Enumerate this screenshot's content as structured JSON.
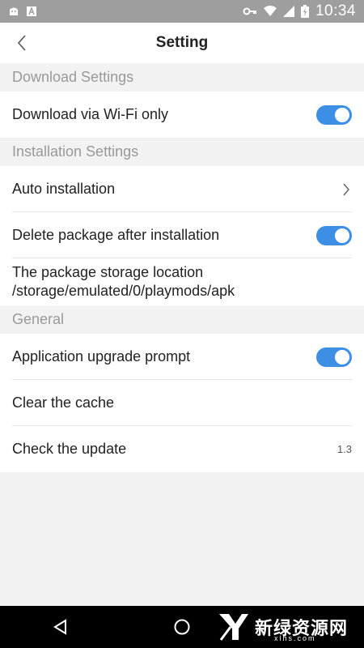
{
  "status_bar": {
    "time": "10:34"
  },
  "header": {
    "title": "Setting"
  },
  "sections": {
    "download": {
      "title": "Download Settings",
      "wifi_only": {
        "label": "Download via Wi-Fi only",
        "enabled": true
      }
    },
    "installation": {
      "title": "Installation Settings",
      "auto_install": {
        "label": "Auto installation"
      },
      "delete_package": {
        "label": "Delete package after installation",
        "enabled": true
      },
      "storage": {
        "label": "The package storage location",
        "path": "/storage/emulated/0/playmods/apk"
      }
    },
    "general": {
      "title": "General",
      "upgrade_prompt": {
        "label": "Application upgrade prompt",
        "enabled": true
      },
      "clear_cache": {
        "label": "Clear the cache"
      },
      "check_update": {
        "label": "Check the update",
        "version": "1.3"
      }
    }
  },
  "watermark": {
    "text": "新绿资源网",
    "sub": "xlhs.com"
  },
  "colors": {
    "accent": "#3d8fe6",
    "status_bar": "#9e9e9e",
    "background": "#f2f2f2"
  }
}
